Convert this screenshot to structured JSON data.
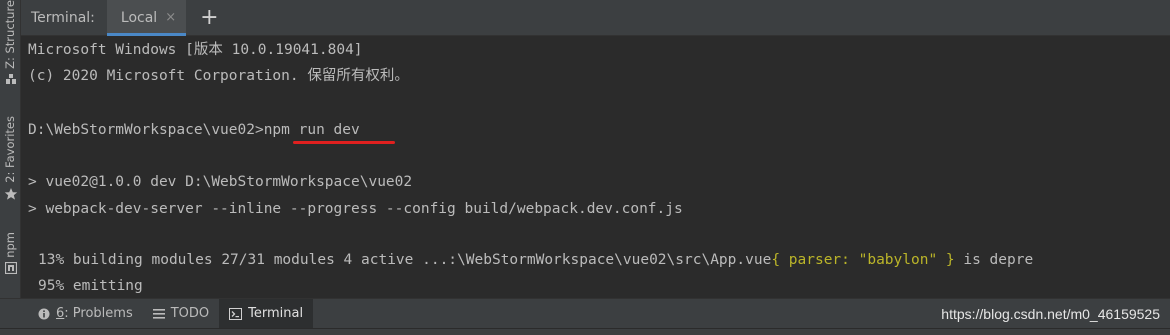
{
  "left_strip": {
    "structure_label": "Z: Structure",
    "favorites_label": "2: Favorites",
    "npm_label": "npm"
  },
  "terminal": {
    "title": "Terminal:",
    "tab_label": "Local",
    "close_glyph": "×",
    "add_glyph": "+"
  },
  "output": {
    "line1": "Microsoft Windows [版本 10.0.19041.804]",
    "line2": "(c) 2020 Microsoft Corporation. 保留所有权利。",
    "prompt": "D:\\WebStormWorkspace\\vue02>",
    "command": "npm run dev",
    "line4": "> vue02@1.0.0 dev D:\\WebStormWorkspace\\vue02",
    "line5": "> webpack-dev-server --inline --progress --config build/webpack.dev.conf.js",
    "line6_a": "13% building modules 27/31 modules 4 active ...:\\WebStormWorkspace\\vue02\\src\\App.vue",
    "line6_b": "{ parser: \"babylon\" }",
    "line6_c": " is depre",
    "line7": "95% emitting"
  },
  "bottom_bar": {
    "problems_num": "6",
    "problems_label": ": Problems",
    "todo_label": "TODO",
    "terminal_label": "Terminal",
    "watermark": "https://blog.csdn.net/m0_46159525"
  },
  "colors": {
    "background": "#2b2b2b",
    "panel": "#3c3f41",
    "accent": "#4a88c7",
    "highlight": "#bbb529",
    "annotation": "#e0201f"
  }
}
